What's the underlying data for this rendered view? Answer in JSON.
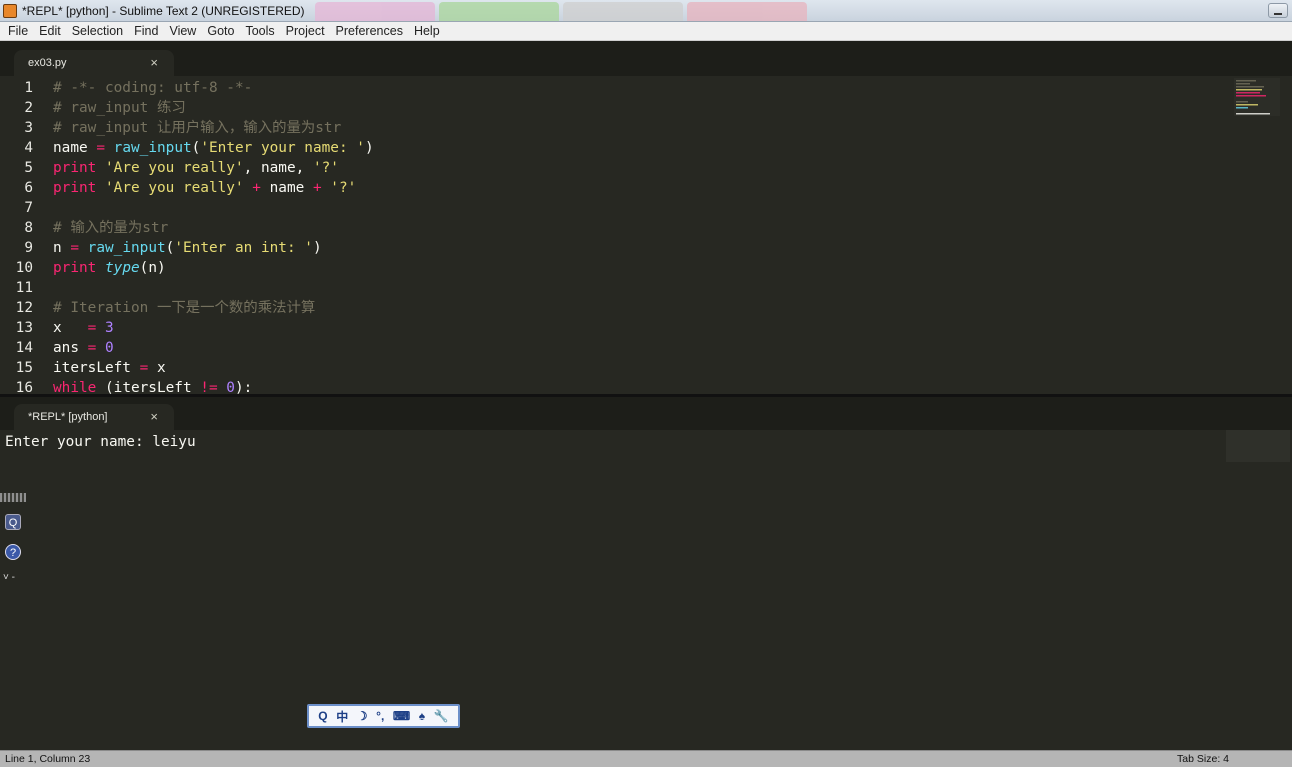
{
  "window": {
    "title": "*REPL* [python] - Sublime Text 2 (UNREGISTERED)"
  },
  "menu": {
    "items": [
      "File",
      "Edit",
      "Selection",
      "Find",
      "View",
      "Goto",
      "Tools",
      "Project",
      "Preferences",
      "Help"
    ]
  },
  "editor_tab": {
    "label": "ex03.py",
    "close": "×"
  },
  "repl_tab": {
    "label": "*REPL* [python]",
    "close": "×"
  },
  "code_lines": [
    [
      [
        "# -*- coding: utf-8 -*-",
        "comment"
      ]
    ],
    [
      [
        "# raw_input 练习",
        "comment"
      ]
    ],
    [
      [
        "# raw_input 让用户输入，输入的量为str",
        "comment"
      ]
    ],
    [
      [
        "name ",
        ""
      ],
      [
        "=",
        "op"
      ],
      [
        " ",
        ""
      ],
      [
        "raw_input",
        "fn"
      ],
      [
        "(",
        ""
      ],
      [
        "'Enter your name: '",
        "str"
      ],
      [
        ")",
        ""
      ]
    ],
    [
      [
        "print",
        "kw"
      ],
      [
        " ",
        ""
      ],
      [
        "'Are you really'",
        "str"
      ],
      [
        ", name, ",
        ""
      ],
      [
        "'?'",
        "str"
      ]
    ],
    [
      [
        "print",
        "kw"
      ],
      [
        " ",
        ""
      ],
      [
        "'Are you really'",
        "str"
      ],
      [
        " ",
        ""
      ],
      [
        "+",
        "op"
      ],
      [
        " name ",
        ""
      ],
      [
        "+",
        "op"
      ],
      [
        " ",
        ""
      ],
      [
        "'?'",
        "str"
      ]
    ],
    [],
    [
      [
        "# 输入的量为str",
        "comment"
      ]
    ],
    [
      [
        "n ",
        ""
      ],
      [
        "=",
        "op"
      ],
      [
        " ",
        ""
      ],
      [
        "raw_input",
        "fn"
      ],
      [
        "(",
        ""
      ],
      [
        "'Enter an int: '",
        "str"
      ],
      [
        ")",
        ""
      ]
    ],
    [
      [
        "print",
        "kw"
      ],
      [
        " ",
        ""
      ],
      [
        "type",
        "type"
      ],
      [
        "(n)",
        ""
      ]
    ],
    [],
    [
      [
        "# Iteration 一下是一个数的乘法计算",
        "comment"
      ]
    ],
    [
      [
        "x   ",
        ""
      ],
      [
        "=",
        "op"
      ],
      [
        " ",
        ""
      ],
      [
        "3",
        "num"
      ]
    ],
    [
      [
        "ans ",
        ""
      ],
      [
        "=",
        "op"
      ],
      [
        " ",
        ""
      ],
      [
        "0",
        "num"
      ]
    ],
    [
      [
        "itersLeft ",
        ""
      ],
      [
        "=",
        "op"
      ],
      [
        " x",
        ""
      ]
    ],
    [
      [
        "while",
        "kw"
      ],
      [
        " (itersLeft ",
        ""
      ],
      [
        "!=",
        "op"
      ],
      [
        " ",
        ""
      ],
      [
        "0",
        "num"
      ],
      [
        "):",
        ""
      ]
    ]
  ],
  "repl": {
    "output": "Enter your name: leiyu"
  },
  "side_icons": {
    "q": "Q",
    "help": "?",
    "arrow": "˅ ‑"
  },
  "ime_bar": {
    "items": [
      "Q",
      "中",
      "☽",
      "°,",
      "⌨",
      "♠",
      "🔧"
    ]
  },
  "status": {
    "position": "Line 1, Column 23",
    "tab_size": "Tab Size: 4"
  }
}
